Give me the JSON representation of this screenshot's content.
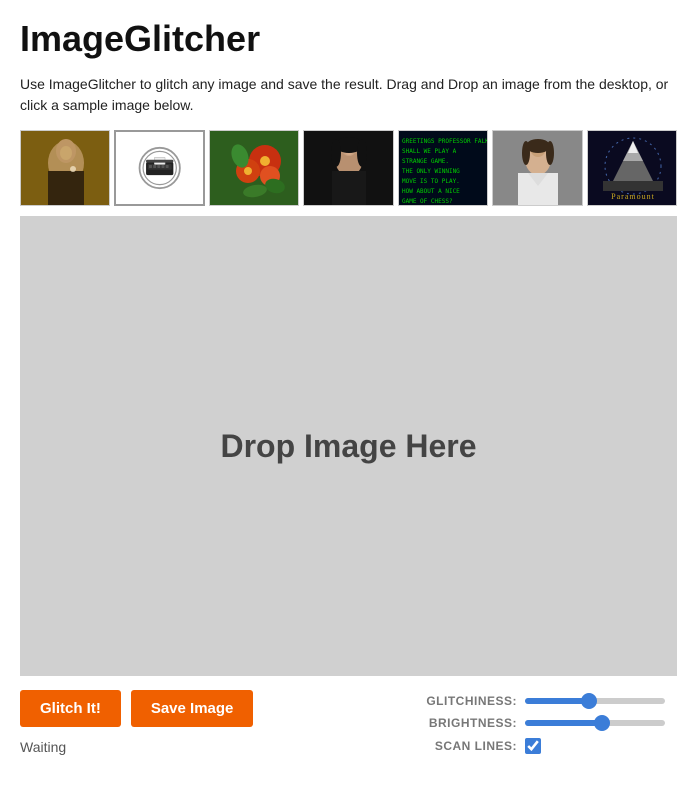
{
  "app": {
    "title": "ImageGlitcher",
    "description": "Use ImageGlitcher to glitch any image and save the result. Drag and Drop an image from the desktop, or click a sample image below."
  },
  "samples": [
    {
      "id": "thumb-1",
      "alt": "Girl with Pearl Earring"
    },
    {
      "id": "thumb-2",
      "alt": "Typewriter icon"
    },
    {
      "id": "thumb-3",
      "alt": "Flowers"
    },
    {
      "id": "thumb-4",
      "alt": "Portrait woman"
    },
    {
      "id": "thumb-5",
      "alt": "WarGames text screen"
    },
    {
      "id": "thumb-6",
      "alt": "White jacket portrait"
    },
    {
      "id": "thumb-7",
      "alt": "Paramount mountain"
    }
  ],
  "dropzone": {
    "text": "Drop Image Here"
  },
  "buttons": {
    "glitch": "Glitch It!",
    "save": "Save Image"
  },
  "status": "Waiting",
  "sliders": {
    "glitchiness": {
      "label": "GLITCHINESS:",
      "value": 50,
      "fill_pct": 46
    },
    "brightness": {
      "label": "BRIGHTNESS:",
      "value": 55,
      "fill_pct": 55
    },
    "scanlines": {
      "label": "SCAN LINES:",
      "checked": true
    }
  }
}
